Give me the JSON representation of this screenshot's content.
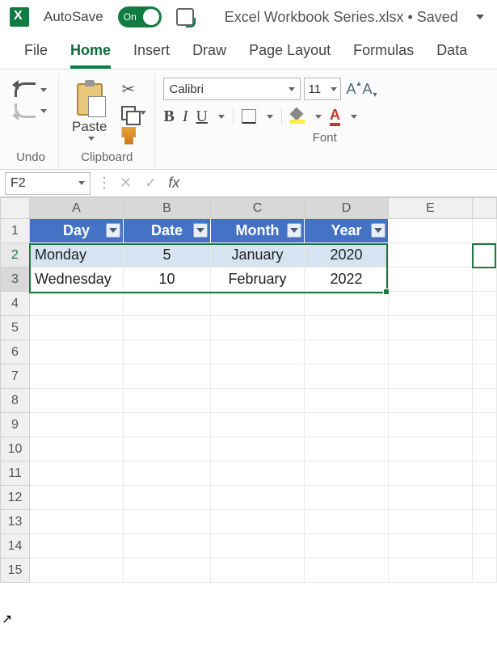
{
  "titlebar": {
    "autosave": "AutoSave",
    "toggle": "On",
    "title": "Excel Workbook Series.xlsx • Saved"
  },
  "tabs": {
    "file": "File",
    "home": "Home",
    "insert": "Insert",
    "draw": "Draw",
    "page_layout": "Page Layout",
    "formulas": "Formulas",
    "data": "Data"
  },
  "ribbon": {
    "undo_group": "Undo",
    "clipboard_group": "Clipboard",
    "paste": "Paste",
    "font_group": "Font",
    "font_name": "Calibri",
    "font_size": "11",
    "bold": "B",
    "italic": "I",
    "underline": "U",
    "grow": "A",
    "shrink": "A",
    "font_color": "A"
  },
  "fbar": {
    "namebox": "F2",
    "fx": "fx"
  },
  "grid": {
    "cols": [
      "A",
      "B",
      "C",
      "D",
      "E"
    ],
    "rows": [
      "1",
      "2",
      "3",
      "4",
      "5",
      "6",
      "7",
      "8",
      "9",
      "10",
      "11",
      "12",
      "13",
      "14",
      "15"
    ],
    "headers": {
      "A": "Day",
      "B": "Date",
      "C": "Month",
      "D": "Year"
    },
    "data": [
      {
        "A": "Monday",
        "B": "5",
        "C": "January",
        "D": "2020"
      },
      {
        "A": "Wednesday",
        "B": "10",
        "C": "February",
        "D": "2022"
      }
    ]
  }
}
